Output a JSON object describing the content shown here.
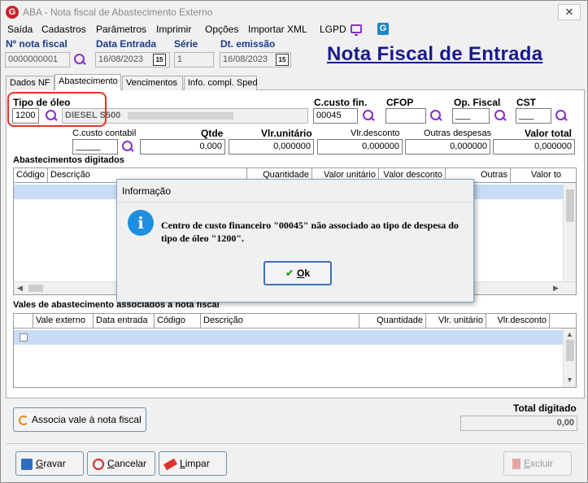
{
  "window": {
    "title": "ABA - Nota fiscal de Abastecimento Externo",
    "close_glyph": "✕",
    "app_icon_letter": "G"
  },
  "menu": [
    "Saída",
    "Cadastros",
    "Parâmetros",
    "Imprimir",
    "Opções",
    "Importar XML",
    "LGPD"
  ],
  "menu_icons": {
    "monitor": "monitor-icon",
    "g_app": "G"
  },
  "header": {
    "nota_fiscal_label": "Nº nota fiscal",
    "nota_fiscal_value": "0000000001",
    "data_entrada_label": "Data Entrada",
    "data_entrada_value": "16/08/2023",
    "serie_label": "Série",
    "serie_value": "1",
    "dt_emissao_label": "Dt. emissão",
    "dt_emissao_value": "16/08/2023",
    "calendar_glyph": "15",
    "page_title": "Nota Fiscal de Entrada"
  },
  "tabs": [
    "Dados NF",
    "Abastecimento",
    "Vencimentos",
    "Info. compl. Sped"
  ],
  "active_tab": "Abastecimento",
  "form": {
    "tipo_oleo_label": "Tipo de óleo",
    "tipo_oleo_code": "1200",
    "tipo_oleo_desc": "DIESEL S500",
    "c_custo_fin_label": "C.custo fin.",
    "c_custo_fin_value": "00045",
    "cfop_label": "CFOP",
    "cfop_value": "",
    "op_fiscal_label": "Op. Fiscal",
    "op_fiscal_value": "___",
    "cst_label": "CST",
    "cst_value": "___",
    "c_custo_contabil_label": "C.custo contabil",
    "c_custo_contabil_value": "_____",
    "qtde_label": "Qtde",
    "qtde_value": "0,000",
    "vlr_unitario_label": "Vlr.unitário",
    "vlr_unitario_value": "0,000000",
    "vlr_desconto_label": "Vlr.desconto",
    "vlr_desconto_value": "0,000000",
    "outras_despesas_label": "Outras despesas",
    "outras_despesas_value": "0,000000",
    "valor_total_label": "Valor total",
    "valor_total_value": "0,000000"
  },
  "abastecimentos": {
    "title": "Abastecimentos digitados",
    "columns": [
      "Código",
      "Descrição",
      "Quantidade",
      "Valor unitário",
      "Valor desconto",
      "Outras",
      "Valor to"
    ]
  },
  "vales": {
    "title": "Vales de abastecimento associados à nota fiscal",
    "columns": [
      "Vale externo",
      "Data entrada",
      "Código",
      "Descrição",
      "Quantidade",
      "Vlr. unitário",
      "Vlr.desconto"
    ]
  },
  "associa_button": "Associa vale à nota fiscal",
  "total": {
    "label": "Total digitado",
    "value": "0,00"
  },
  "buttons": {
    "gravar_u": "G",
    "gravar_rest": "ravar",
    "cancelar_u": "C",
    "cancelar_rest": "ancelar",
    "limpar_u": "L",
    "limpar_rest": "impar",
    "excluir_u": "E",
    "excluir_rest": "xcluir"
  },
  "dialog": {
    "title": "Informação",
    "message": "Centro de custo financeiro \"00045\" não associado ao tipo de despesa do tipo de óleo \"1200\".",
    "ok_u": "O",
    "ok_rest": "k",
    "info_glyph": "i",
    "ok_check": "✔"
  },
  "colors": {
    "accent_title": "#1a1a8a",
    "label_blue": "#1a3a8a",
    "highlight_red": "#e2342c",
    "icon_purple": "#8b2fc9",
    "info_blue": "#1e8fe0",
    "selected_row": "#c8dcf5"
  }
}
